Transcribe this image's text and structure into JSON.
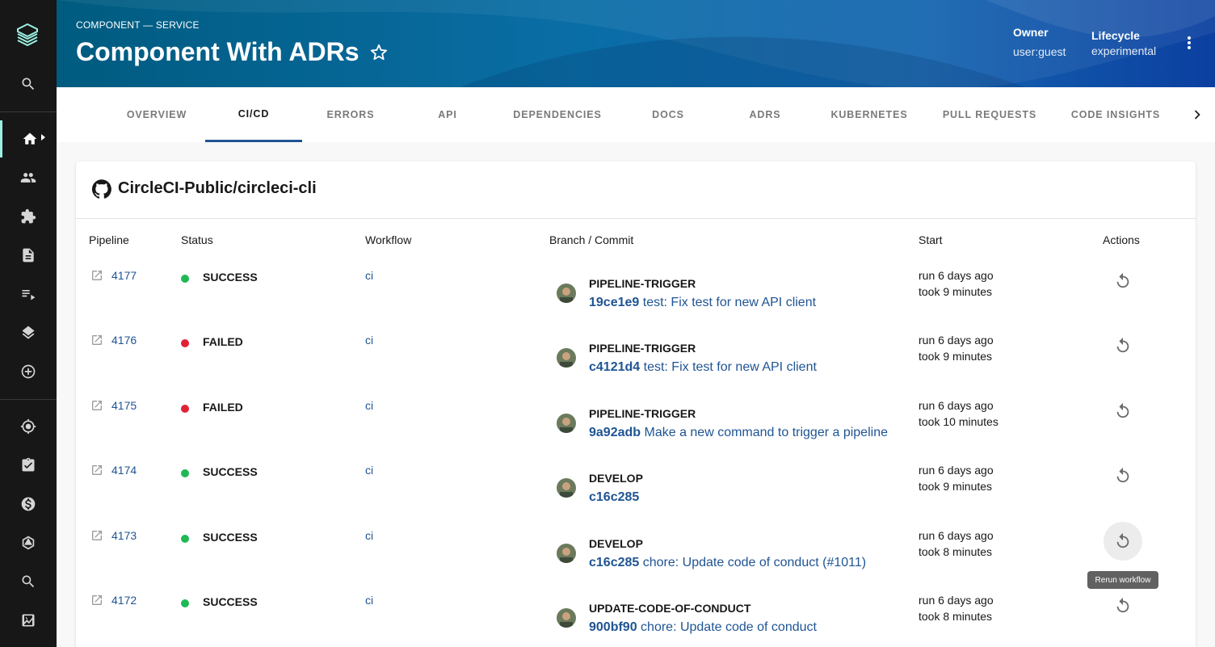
{
  "sidebar": {
    "logo": "backstage-logo-icon",
    "items": [
      {
        "icon": "search-icon"
      },
      {
        "icon": "home-icon",
        "active": true
      },
      {
        "icon": "group-icon"
      },
      {
        "icon": "puzzle-icon"
      },
      {
        "icon": "document-icon"
      },
      {
        "icon": "playlist-icon"
      },
      {
        "icon": "layers-icon"
      },
      {
        "icon": "add-circle-icon"
      },
      {
        "icon": "gps-icon"
      },
      {
        "icon": "assignment-icon"
      },
      {
        "icon": "money-icon"
      },
      {
        "icon": "graphql-icon"
      },
      {
        "icon": "search-icon"
      },
      {
        "icon": "score-icon"
      }
    ]
  },
  "header": {
    "kind": "COMPONENT — SERVICE",
    "title": "Component With ADRs",
    "owner_label": "Owner",
    "owner_value": "user:guest",
    "lifecycle_label": "Lifecycle",
    "lifecycle_value": "experimental"
  },
  "tabs": [
    {
      "label": "OVERVIEW"
    },
    {
      "label": "CI/CD",
      "active": true
    },
    {
      "label": "ERRORS"
    },
    {
      "label": "API"
    },
    {
      "label": "DEPENDENCIES"
    },
    {
      "label": "DOCS"
    },
    {
      "label": "ADRS"
    },
    {
      "label": "KUBERNETES"
    },
    {
      "label": "PULL REQUESTS"
    },
    {
      "label": "CODE INSIGHTS"
    }
  ],
  "card": {
    "title": "CircleCI-Public/circleci-cli",
    "columns": {
      "pipeline": "Pipeline",
      "status": "Status",
      "workflow": "Workflow",
      "branch": "Branch / Commit",
      "start": "Start",
      "actions": "Actions"
    },
    "rows": [
      {
        "pipeline": "4177",
        "status": "SUCCESS",
        "workflow": "ci",
        "branch": "PIPELINE-TRIGGER",
        "hash": "19ce1e9",
        "message": " test: Fix test for new API client",
        "start": "run 6 days ago",
        "duration": "took 9 minutes"
      },
      {
        "pipeline": "4176",
        "status": "FAILED",
        "workflow": "ci",
        "branch": "PIPELINE-TRIGGER",
        "hash": "c4121d4",
        "message": " test: Fix test for new API client",
        "start": "run 6 days ago",
        "duration": "took 9 minutes"
      },
      {
        "pipeline": "4175",
        "status": "FAILED",
        "workflow": "ci",
        "branch": "PIPELINE-TRIGGER",
        "hash": "9a92adb",
        "message": " Make a new command to trigger a pipeline",
        "start": "run 6 days ago",
        "duration": "took 10 minutes"
      },
      {
        "pipeline": "4174",
        "status": "SUCCESS",
        "workflow": "ci",
        "branch": "DEVELOP",
        "hash": "c16c285",
        "message": "",
        "start": "run 6 days ago",
        "duration": "took 9 minutes"
      },
      {
        "pipeline": "4173",
        "status": "SUCCESS",
        "workflow": "ci",
        "branch": "DEVELOP",
        "hash": "c16c285",
        "message": " chore: Update code of conduct (#1011)",
        "start": "run 6 days ago",
        "duration": "took 8 minutes"
      },
      {
        "pipeline": "4172",
        "status": "SUCCESS",
        "workflow": "ci",
        "branch": "UPDATE-CODE-OF-CONDUCT",
        "hash": "900bf90",
        "message": " chore: Update code of conduct",
        "start": "run 6 days ago",
        "duration": "took 8 minutes"
      }
    ],
    "tooltip": "Rerun workflow"
  },
  "colors": {
    "success": "#1db954",
    "failed": "#e22134",
    "link": "#1f5493",
    "sidebar_bg": "#171717",
    "active_accent": "#9bf0e1"
  }
}
